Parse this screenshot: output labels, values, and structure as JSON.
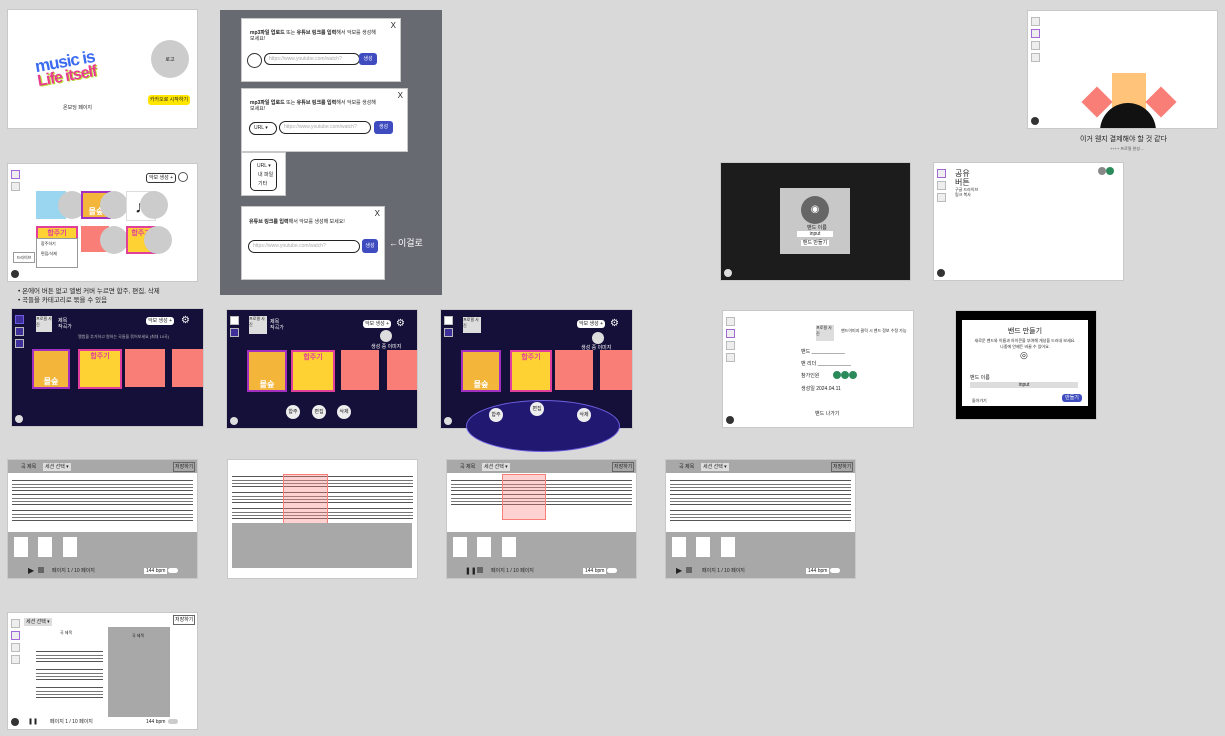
{
  "intro": {
    "logo_line1": "music is",
    "logo_line2": "Life itself",
    "avatar_label": "로고",
    "page_label": "온보딩 페이지",
    "kakao_button": "카카오로 시작하기"
  },
  "modal1": {
    "title_bold1": "mp3파일 업로드",
    "title_mid": "또는",
    "title_bold2": "유튜브 링크를 입력",
    "title_rest": "해서 악보를 생성해 보세요!",
    "placeholder": "https://www.youtube.com/watch?",
    "button": "생성",
    "close": "X"
  },
  "modal2": {
    "title_bold1": "mp3파일 업로드",
    "title_mid": "또는",
    "title_bold2": "유튜브 링크를 입력",
    "title_rest": "해서 악보를 생성해 보세요!",
    "select": "URL",
    "placeholder": "https://www.youtube.com/watch?",
    "button": "생성",
    "close": "X"
  },
  "dropdown": {
    "items": [
      "URL",
      "내 파일",
      "기타"
    ]
  },
  "modal3": {
    "title_bold": "유튜브 링크를 입력",
    "title_rest": "해서 악보를 생성해 보세요!",
    "placeholder": "https://www.youtube.com/watch?",
    "button": "생성",
    "close": "X",
    "arrow_note": "←이걸로"
  },
  "pay": {
    "caption": "이거 웬지 결제해야 할 것 같다",
    "sub": "++++ 프로필 완성...."
  },
  "library": {
    "create_button": "악보 생성 +",
    "menu_item1": "합주하기",
    "menu_item2": "편집/삭제",
    "menu_item3": "드라이브"
  },
  "notes": [
    "온에어 버튼 없고 앨범 커버 누르면 합주, 편집, 삭제",
    "곡들을 카테고리로 묶을 수 있음"
  ],
  "dark1": {
    "profile": "프로필 사진",
    "title1": "제목",
    "title2": "작곡가",
    "desc": "앨범을 추가하고 원하는 곡들을 묶어보세요 (최대 10곡)",
    "create": "악보 생성 +"
  },
  "dark2": {
    "profile": "프로필 사진",
    "title1": "제목",
    "title2": "작곡가",
    "create": "악보 생성 +",
    "status": "생성 중 이미지",
    "btn_play": "합주",
    "btn_edit": "편집",
    "btn_delete": "삭제"
  },
  "dark3": {
    "profile": "프로필 사진",
    "create": "악보 생성 +",
    "status": "생성 중 이미지",
    "btn_play": "합주",
    "btn_edit": "편집",
    "btn_delete": "삭제"
  },
  "cover_text": {
    "cat": "몰숲",
    "piano": "합주기"
  },
  "camera": {
    "label": "밴드 이름",
    "input": "input",
    "button": "밴드 만들기"
  },
  "share": {
    "title1": "공유",
    "title2": "버튼",
    "sub1": "구글 드라이브",
    "sub2": "링크 복사"
  },
  "profile": {
    "photo": "프로필 사진",
    "desc": "밴드이미지 클릭 시 밴드 정보 수정 가능",
    "band": "밴드",
    "leader": "밴 리더",
    "members": "참가인원",
    "created": "생성일 2024.04.11",
    "leave": "밴드 나가기"
  },
  "band_modal": {
    "title": "밴드 만들기",
    "desc1": "새로운 밴드와 이름과 아이콘을 부여해 개성을 드러내 보세요.",
    "desc2": "나중에 언제든 바꿀 수 있어요.",
    "label": "밴드 이름",
    "input": "input",
    "back": "돌아가기",
    "submit": "만들기"
  },
  "editor": {
    "title": "곡 제목",
    "select": "세션 선택",
    "save": "저장하기",
    "page": "페이지 1 / 10 페이지",
    "bpm": "144 bpm"
  },
  "editor_last": {
    "select": "세션 선택",
    "save": "저장하기",
    "score_title": "곡 제목",
    "page": "페이지 1 / 10 페이지",
    "bpm": "144 bpm"
  },
  "colors": {
    "dark_bg": "#15103a",
    "salmon": "#fa7e78",
    "accent": "#3e4cbf",
    "yellow": "#ffe600",
    "modal_bg": "#686a72"
  }
}
